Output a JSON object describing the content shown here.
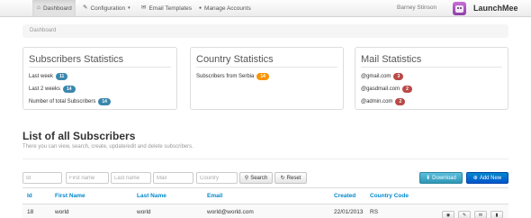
{
  "navbar": {
    "items": [
      {
        "label": "Dashboard",
        "icon": "home-icon",
        "glyph": "⌂",
        "active": true
      },
      {
        "label": "Configuration",
        "icon": "wrench-icon",
        "glyph": "✎",
        "active": false,
        "caret": "▾"
      },
      {
        "label": "Email Templates",
        "icon": "envelope-icon",
        "glyph": "✉",
        "active": false
      },
      {
        "label": "Manage Accounts",
        "icon": "user-icon",
        "glyph": "●",
        "active": false
      }
    ],
    "user_name": "Barney Stinson",
    "brand": "LaunchMee"
  },
  "breadcrumb": "Dashboard",
  "subscribers_stats": {
    "title": "Subscribers Statistics",
    "rows": [
      {
        "label": "Last week",
        "value": "11"
      },
      {
        "label": "Last 2 weeks",
        "value": "14"
      },
      {
        "label": "Number of total Subscribers",
        "value": "14"
      }
    ]
  },
  "country_stats": {
    "title": "Country Statistics",
    "rows": [
      {
        "label": "Subscribers from Serbia",
        "value": "14"
      }
    ]
  },
  "mail_stats": {
    "title": "Mail Statistics",
    "rows": [
      {
        "label": "@gmail.com",
        "value": "3"
      },
      {
        "label": "@gasdmail.com",
        "value": "2"
      },
      {
        "label": "@admin.com",
        "value": "2"
      }
    ]
  },
  "list": {
    "title": "List of all Subscribers",
    "description": "There you can view, search, create, update/edit and delete subscribers."
  },
  "filters": {
    "id_placeholder": "Id",
    "first_name_placeholder": "First name",
    "last_name_placeholder": "Last name",
    "mail_placeholder": "Mail",
    "country_placeholder": "Country",
    "search_label": "Search",
    "reset_label": "Reset",
    "download_label": "Download",
    "add_new_label": "Add New"
  },
  "table": {
    "headers": [
      "Id",
      "First Name",
      "Last Name",
      "Email",
      "Created",
      "Country Code"
    ],
    "rows": [
      [
        "18",
        "world",
        "world",
        "world@world.com",
        "22/01/2013",
        "RS"
      ]
    ],
    "action_icons": [
      "eye-icon",
      "pencil-icon",
      "envelope-icon",
      "trash-icon"
    ]
  },
  "colors": {
    "badge_blue": "#3a87ad",
    "badge_orange": "#f89406",
    "badge_red": "#b94a48",
    "link_blue": "#0088cc",
    "download_button": "#49afcd",
    "add_button": "#006dcc"
  }
}
